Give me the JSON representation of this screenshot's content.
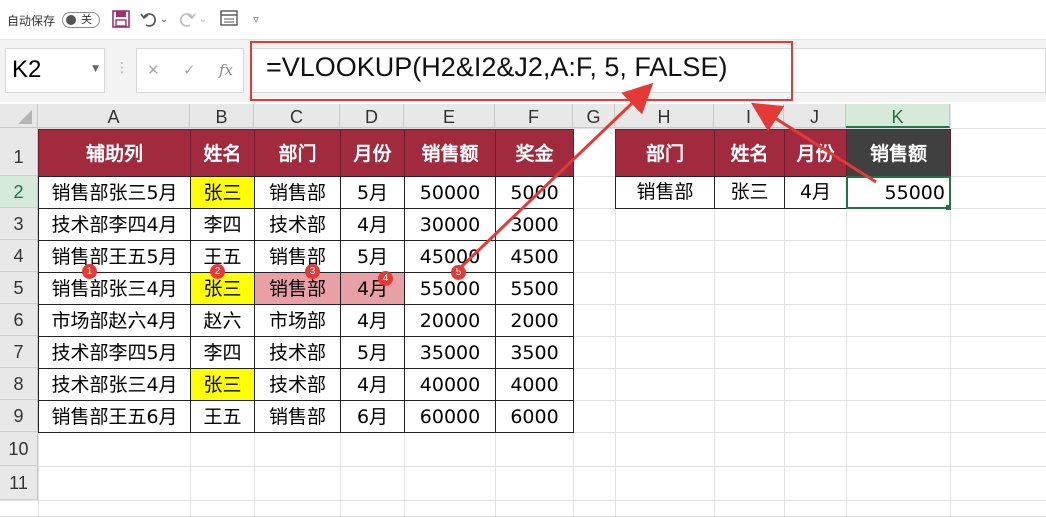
{
  "toolbar": {
    "autosave_label": "自动保存",
    "autosave_state": "关"
  },
  "formula_bar": {
    "name_box": "K2",
    "formula": "=VLOOKUP(H2&I2&J2,A:F, 5, FALSE)"
  },
  "columns": [
    "A",
    "B",
    "C",
    "D",
    "E",
    "F",
    "G",
    "H",
    "I",
    "J",
    "K"
  ],
  "rows": [
    "1",
    "2",
    "3",
    "4",
    "5",
    "6",
    "7",
    "8",
    "9",
    "10",
    "11"
  ],
  "left_table": {
    "headers": [
      "辅助列",
      "姓名",
      "部门",
      "月份",
      "销售额",
      "奖金"
    ],
    "rows": [
      [
        "销售部张三5月",
        "张三",
        "销售部",
        "5月",
        "50000",
        "5000"
      ],
      [
        "技术部李四4月",
        "李四",
        "技术部",
        "4月",
        "30000",
        "3000"
      ],
      [
        "销售部王五5月",
        "王五",
        "销售部",
        "5月",
        "45000",
        "4500"
      ],
      [
        "销售部张三4月",
        "张三",
        "销售部",
        "4月",
        "55000",
        "5500"
      ],
      [
        "市场部赵六4月",
        "赵六",
        "市场部",
        "4月",
        "20000",
        "2000"
      ],
      [
        "技术部李四5月",
        "李四",
        "技术部",
        "5月",
        "35000",
        "3500"
      ],
      [
        "技术部张三4月",
        "张三",
        "技术部",
        "4月",
        "40000",
        "4000"
      ],
      [
        "销售部王五6月",
        "王五",
        "销售部",
        "6月",
        "60000",
        "6000"
      ]
    ]
  },
  "right_table": {
    "headers": [
      "部门",
      "姓名",
      "月份",
      "销售额"
    ],
    "row": [
      "销售部",
      "张三",
      "4月",
      "55000"
    ]
  },
  "markers": [
    "1",
    "2",
    "3",
    "4",
    "5"
  ],
  "colors": {
    "header_red": "#a12a3f",
    "header_dark": "#404040",
    "highlight_yellow": "#ffff00",
    "highlight_pink": "#e8a0a6",
    "annotation_red": "#e53935",
    "selection_green": "#217346"
  }
}
